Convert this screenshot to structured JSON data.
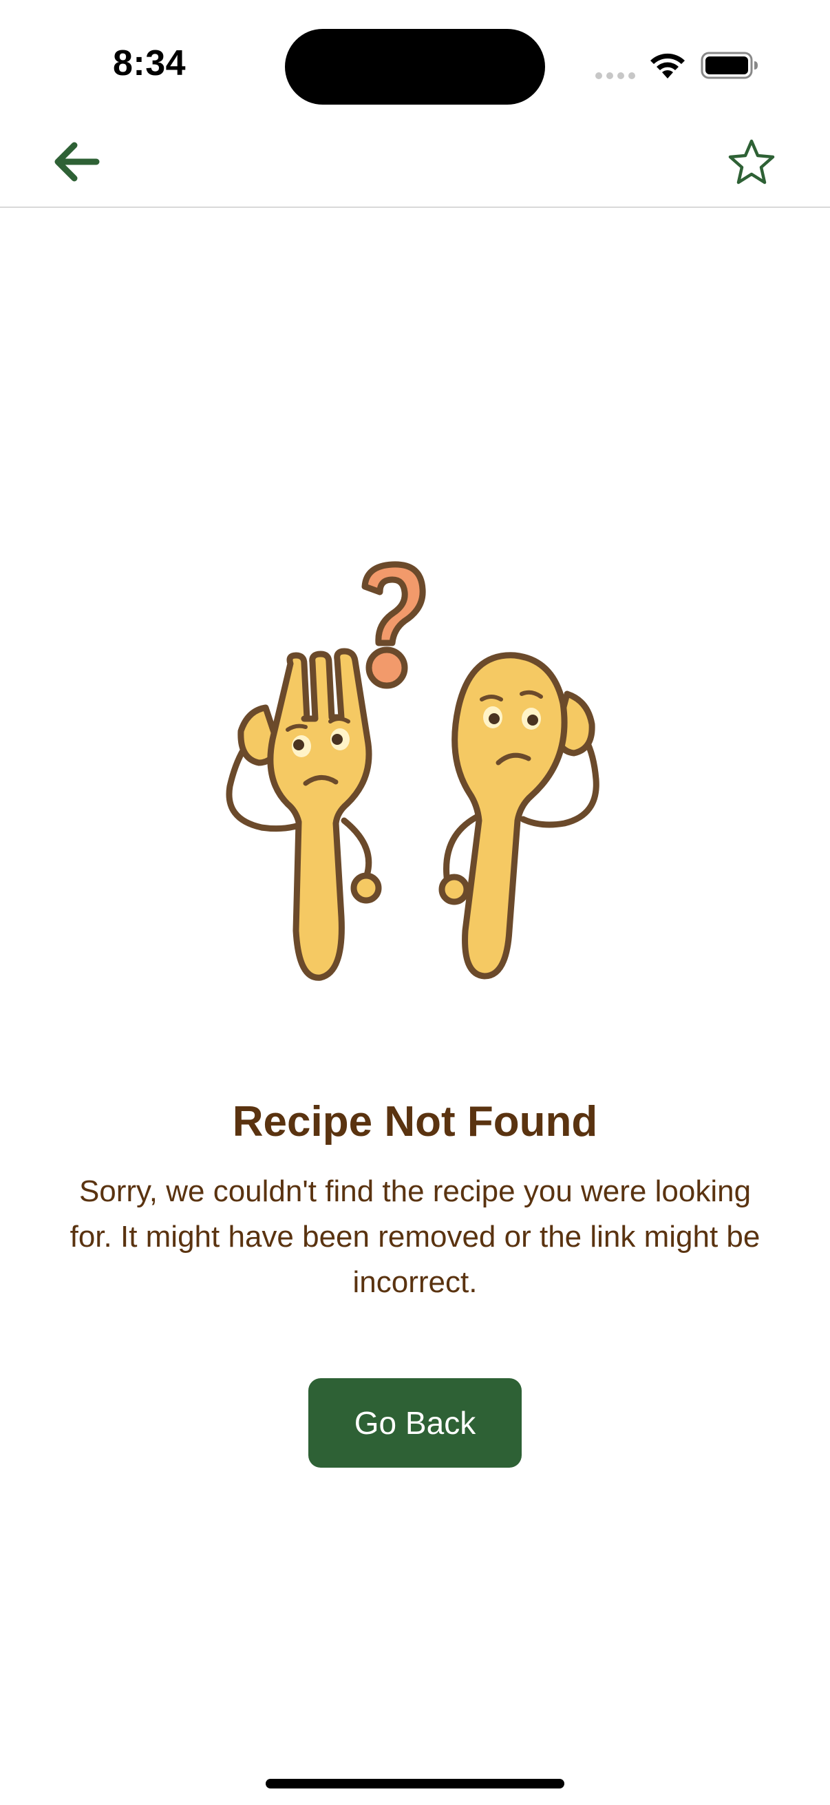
{
  "status_bar": {
    "time": "8:34"
  },
  "nav": {
    "back_icon": "arrow-left-icon",
    "favorite_icon": "star-outline-icon"
  },
  "colors": {
    "brand_green": "#2e6135",
    "title_brown": "#5a3310",
    "illustration_yellow": "#f5c963",
    "illustration_outline": "#6b4a2b",
    "question_mark": "#f29a6b"
  },
  "illustration": {
    "icon": "confused-fork-and-spoon-illustration"
  },
  "content": {
    "title": "Recipe Not Found",
    "message": "Sorry, we couldn't find the recipe you were looking for. It might have been removed or the link might be incorrect.",
    "button_label": "Go Back"
  }
}
